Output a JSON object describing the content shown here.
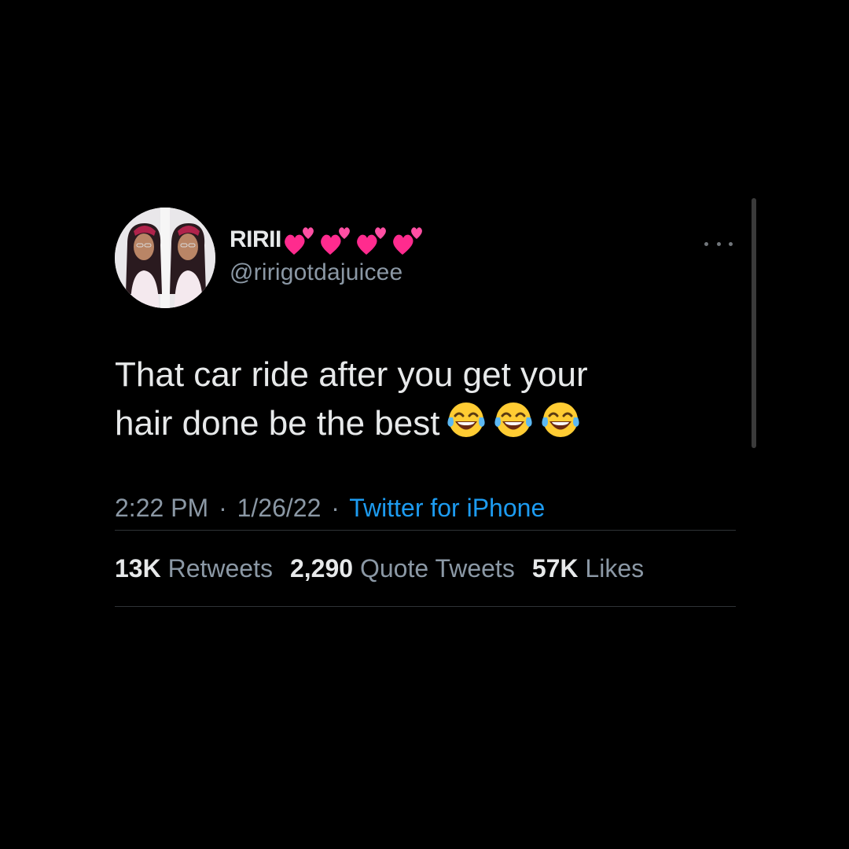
{
  "tweet": {
    "display_name": "RIRII",
    "name_emojis": [
      "two-hearts-emoji",
      "two-hearts-emoji",
      "two-hearts-emoji",
      "two-hearts-emoji"
    ],
    "handle": "@ririgotdajuicee",
    "text_line1": "That car ride after you get your",
    "text_line2": "hair done be the best",
    "text_emojis": [
      "tears-of-joy-emoji",
      "tears-of-joy-emoji",
      "tears-of-joy-emoji"
    ],
    "time": "2:22 PM",
    "date": "1/26/22",
    "separator": "·",
    "source": "Twitter for iPhone",
    "stats": {
      "retweets_count": "13K",
      "retweets_label": "Retweets",
      "quotes_count": "2,290",
      "quotes_label": "Quote Tweets",
      "likes_count": "57K",
      "likes_label": "Likes"
    }
  },
  "colors": {
    "background": "#000000",
    "text_primary": "#e7e9ea",
    "text_secondary": "#8b98a5",
    "link": "#1d9bf0",
    "divider": "#2f3336"
  }
}
